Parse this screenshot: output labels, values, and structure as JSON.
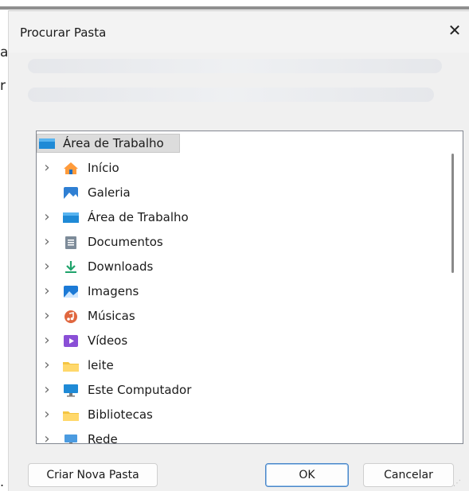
{
  "dialog": {
    "title": "Procurar Pasta",
    "close_glyph": "✕",
    "background_fragments": {
      "a": "a",
      "r": "r",
      "dot": "."
    }
  },
  "tree": {
    "root": {
      "label": "Área de Trabalho",
      "icon": "desktop-icon",
      "selected": true
    },
    "items": [
      {
        "label": "Início",
        "icon": "home-icon",
        "expandable": true
      },
      {
        "label": "Galeria",
        "icon": "gallery-icon",
        "expandable": false
      },
      {
        "label": "Área de Trabalho",
        "icon": "desktop-icon",
        "expandable": true
      },
      {
        "label": "Documentos",
        "icon": "document-icon",
        "expandable": true
      },
      {
        "label": "Downloads",
        "icon": "download-icon",
        "expandable": true
      },
      {
        "label": "Imagens",
        "icon": "images-icon",
        "expandable": true
      },
      {
        "label": "Músicas",
        "icon": "music-icon",
        "expandable": true
      },
      {
        "label": "Vídeos",
        "icon": "video-icon",
        "expandable": true
      },
      {
        "label": "leite",
        "icon": "folder-icon",
        "expandable": true
      },
      {
        "label": "Este Computador",
        "icon": "computer-icon",
        "expandable": true
      },
      {
        "label": "Bibliotecas",
        "icon": "folder-icon",
        "expandable": true
      },
      {
        "label": "Rede",
        "icon": "network-icon",
        "expandable": true
      }
    ]
  },
  "buttons": {
    "new_folder": "Criar Nova Pasta",
    "ok": "OK",
    "cancel": "Cancelar"
  }
}
